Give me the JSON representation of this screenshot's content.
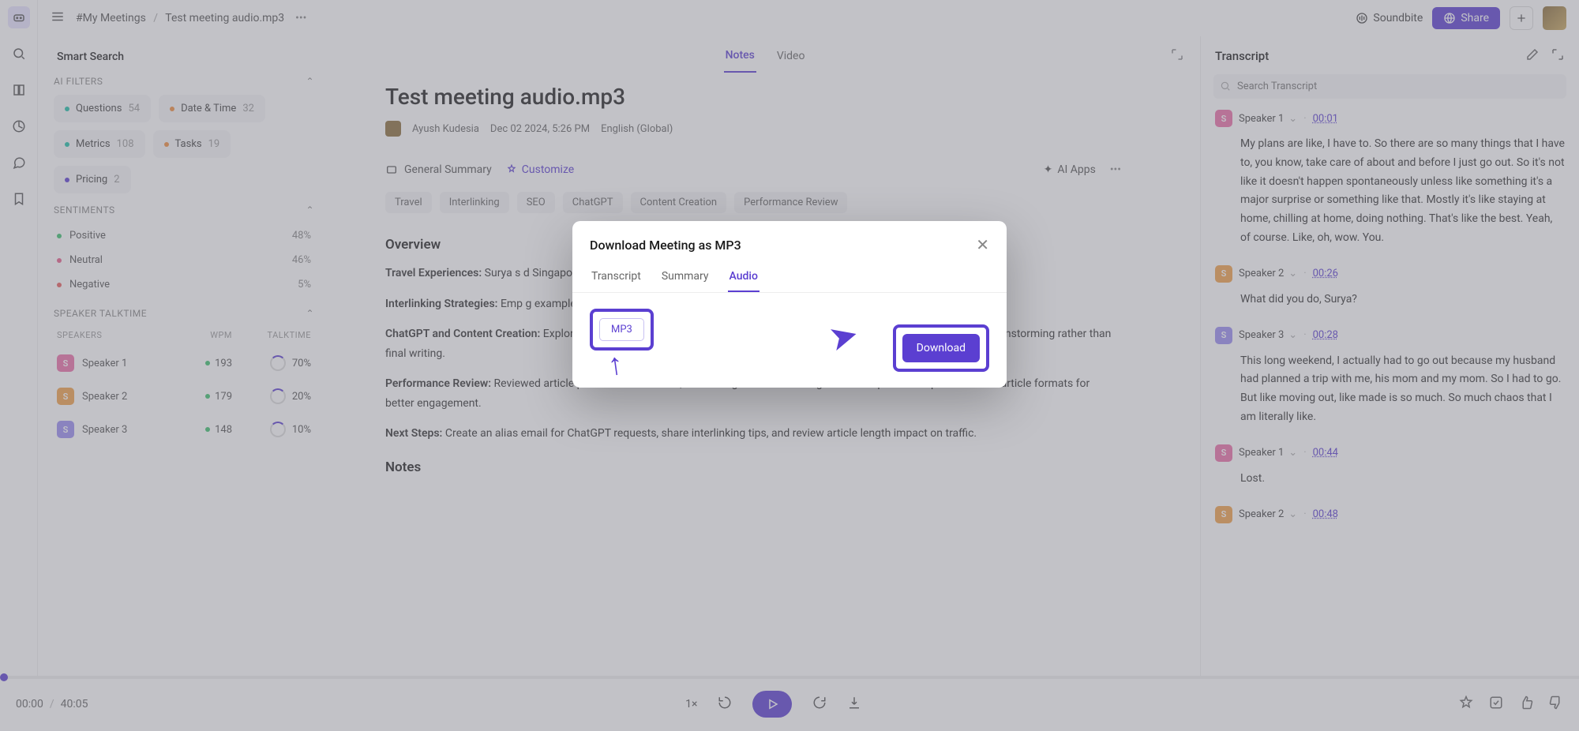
{
  "breadcrumb": {
    "folder": "#My Meetings",
    "file": "Test meeting audio.mp3"
  },
  "topbar": {
    "soundbite": "Soundbite",
    "share": "Share"
  },
  "sidebar": {
    "smart_search": "Smart Search",
    "filters_label": "AI FILTERS",
    "filters": [
      {
        "dot": "teal",
        "label": "Questions",
        "count": "54"
      },
      {
        "dot": "orange",
        "label": "Date & Time",
        "count": "32"
      },
      {
        "dot": "teal",
        "label": "Metrics",
        "count": "108"
      },
      {
        "dot": "orange",
        "label": "Tasks",
        "count": "19"
      },
      {
        "dot": "blue",
        "label": "Pricing",
        "count": "2"
      }
    ],
    "sentiments_label": "SENTIMENTS",
    "sentiments": [
      {
        "dot": "green",
        "label": "Positive",
        "pct": "48%"
      },
      {
        "dot": "pink",
        "label": "Neutral",
        "pct": "46%"
      },
      {
        "dot": "red",
        "label": "Negative",
        "pct": "5%"
      }
    ],
    "talktime_label": "SPEAKER TALKTIME",
    "speakers_head": {
      "a": "SPEAKERS",
      "b": "WPM",
      "c": "TALKTIME"
    },
    "speakers": [
      {
        "color": "pink",
        "initial": "S",
        "name": "Speaker 1",
        "wpm": "193",
        "pct": "70%"
      },
      {
        "color": "orange",
        "initial": "S",
        "name": "Speaker 2",
        "wpm": "179",
        "pct": "20%"
      },
      {
        "color": "purple",
        "initial": "S",
        "name": "Speaker 3",
        "wpm": "148",
        "pct": "10%"
      }
    ]
  },
  "center": {
    "tabs": {
      "notes": "Notes",
      "video": "Video"
    },
    "title": "Test meeting audio.mp3",
    "author": "Ayush Kudesia",
    "date": "Dec 02 2024, 5:26 PM",
    "lang": "English (Global)",
    "summary_type": "General Summary",
    "customize": "Customize",
    "ai_apps": "AI Apps",
    "tags": [
      "Travel",
      "Interlinking",
      "SEO",
      "ChatGPT",
      "Content Creation",
      "Performance Review"
    ],
    "overview_h": "Overview",
    "p1_b": "Travel Experiences:",
    "p1": " Surya s                                                                                             d Singapore, exciting participants.",
    "p2_b": "Interlinking Strategies:",
    "p2": " Emp                                                                               g examples and tips for using slugs and",
    "p3_b": "ChatGPT and Content Creation:",
    "p3": " Explored ChatGPT's role in content creation, highlighting limitations, suggested using it for brainstorming rather than final writing.",
    "p4_b": "Performance Review:",
    "p4": " Reviewed article performance metrics, discussing workload management and plans to experiment with article formats for better engagement.",
    "p5_b": "Next Steps:",
    "p5": " Create an alias email for ChatGPT requests, share interlinking tips, and review article length impact on traffic.",
    "notes_h": "Notes"
  },
  "transcript": {
    "title": "Transcript",
    "search_ph": "Search Transcript",
    "items": [
      {
        "color": "pink",
        "initial": "S",
        "speaker": "Speaker 1",
        "ts": "00:01",
        "text": "My plans are like, I have to. So there are so many things that I have to, you know, take care of about and before I just go out. So it's not like it doesn't happen spontaneously unless like something it's a major surprise or something like that. Mostly it's like staying at home, chilling at home, doing nothing. That's like the best. Yeah, of course. Like, oh, wow. You."
      },
      {
        "color": "orange",
        "initial": "S",
        "speaker": "Speaker 2",
        "ts": "00:26",
        "text": "What did you do, Surya?"
      },
      {
        "color": "purple",
        "initial": "S",
        "speaker": "Speaker 3",
        "ts": "00:28",
        "text": "This long weekend, I actually had to go out because my husband had planned a trip with me, his mom and my mom. So I had to go. But like moving out, like made is so much. So much chaos that I am literally like."
      },
      {
        "color": "pink",
        "initial": "S",
        "speaker": "Speaker 1",
        "ts": "00:44",
        "text": "Lost."
      },
      {
        "color": "orange",
        "initial": "S",
        "speaker": "Speaker 2",
        "ts": "00:48",
        "text": ""
      }
    ]
  },
  "player": {
    "time": "00:00",
    "dur": "40:05",
    "speed": "1×"
  },
  "modal": {
    "title": "Download Meeting as MP3",
    "tabs": {
      "transcript": "Transcript",
      "summary": "Summary",
      "audio": "Audio"
    },
    "format": "MP3",
    "download": "Download"
  }
}
